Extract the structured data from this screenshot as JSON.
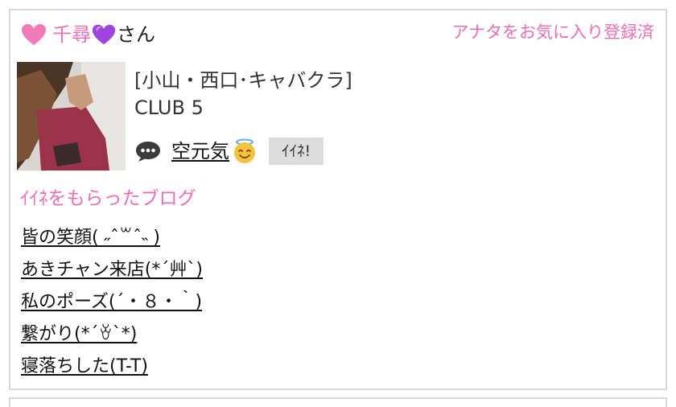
{
  "profile": {
    "name_heart_icon": "pink-heart-icon",
    "name": "千尋",
    "name_suffix_icon": "purple-heart-icon",
    "honorific": "さん",
    "favorite_status": "アナタをお気に入り登録済",
    "store": "[小山・西口･キャバクラ]",
    "club": "CLUB 5",
    "status_icon": "speech-bubble-icon",
    "status_text": "空元気",
    "status_emoji_icon": "smiling-face-with-halo-icon",
    "iine_label": "ｲｲﾈ!"
  },
  "blogs": {
    "heading": "ｲｲﾈをもらったブログ",
    "items": [
      "皆の笑顔( ˶ˆ꒳ˆ˵ )",
      "あきチャン来店(*´艸`)",
      "私のポーズ(´・８・｀)",
      "繋がり(*´ꈊ`*)",
      "寝落ちした(T-T)"
    ]
  },
  "colors": {
    "accent_pink": "#ec6fb3",
    "purple_heart": "#a044e0",
    "button_gray": "#dddddd",
    "border_gray": "#d9d9d9"
  }
}
